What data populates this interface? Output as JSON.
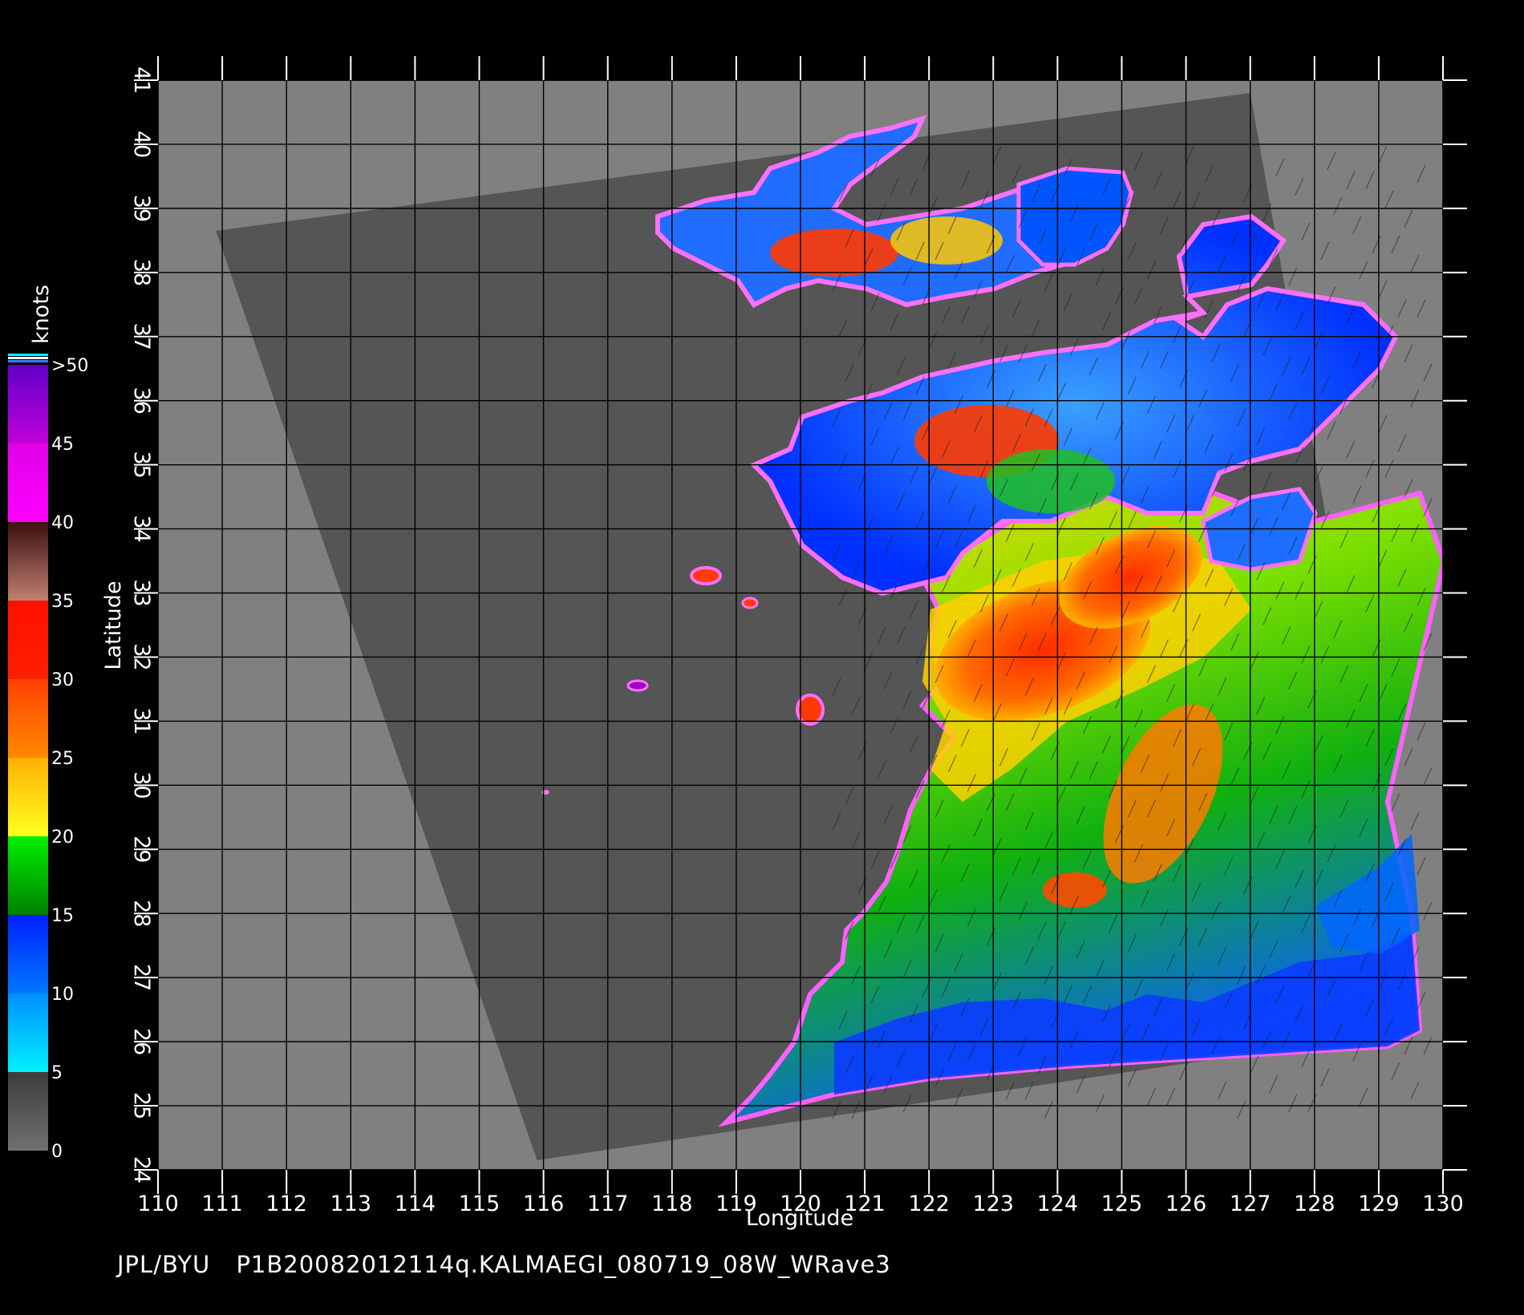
{
  "map": {
    "xlabel": "Longitude",
    "ylabel": "Latitude",
    "lon_range": [
      110,
      130
    ],
    "lat_range": [
      24,
      41
    ],
    "lon_ticks": [
      "110",
      "111",
      "112",
      "113",
      "114",
      "115",
      "116",
      "117",
      "118",
      "119",
      "120",
      "121",
      "122",
      "123",
      "124",
      "125",
      "126",
      "127",
      "128",
      "129",
      "130"
    ],
    "lat_ticks": [
      "24",
      "25",
      "26",
      "27",
      "28",
      "29",
      "30",
      "31",
      "32",
      "33",
      "34",
      "35",
      "36",
      "37",
      "38",
      "39",
      "40",
      "41"
    ],
    "background_color": "#808080",
    "swath_background_color": "#555555",
    "swath_corners_lonlat": [
      [
        110.9,
        38.65
      ],
      [
        127.0,
        40.8
      ],
      [
        129.6,
        26.2
      ],
      [
        115.9,
        24.15
      ]
    ]
  },
  "colorbar": {
    "unit": "knots",
    "labels": [
      ">50",
      "45",
      "40",
      "35",
      "30",
      "25",
      "20",
      "15",
      "10",
      "5",
      "0"
    ],
    "bands": [
      {
        "from": 0,
        "to": 5,
        "colors": [
          "#707070",
          "#3c3c3c"
        ]
      },
      {
        "from": 5,
        "to": 10,
        "colors": [
          "#00f0ff",
          "#0090ff"
        ]
      },
      {
        "from": 10,
        "to": 15,
        "colors": [
          "#0078ff",
          "#0020ff"
        ]
      },
      {
        "from": 15,
        "to": 20,
        "colors": [
          "#008000",
          "#00f000"
        ]
      },
      {
        "from": 20,
        "to": 25,
        "colors": [
          "#ffff20",
          "#ffb000"
        ]
      },
      {
        "from": 25,
        "to": 30,
        "colors": [
          "#ff8a00",
          "#ff4000"
        ]
      },
      {
        "from": 30,
        "to": 35,
        "colors": [
          "#ff2000",
          "#ff1000"
        ]
      },
      {
        "from": 35,
        "to": 40,
        "colors": [
          "#c08070",
          "#3a1010"
        ]
      },
      {
        "from": 40,
        "to": 45,
        "colors": [
          "#ff00ff",
          "#e000e8"
        ]
      },
      {
        "from": 45,
        "to": 50,
        "colors": [
          "#c000d8",
          "#6000c8"
        ]
      }
    ]
  },
  "footer": {
    "source": "JPL/BYU",
    "product": "P1B20082012114q.KALMAEGI_080719_08W_WRave3"
  }
}
